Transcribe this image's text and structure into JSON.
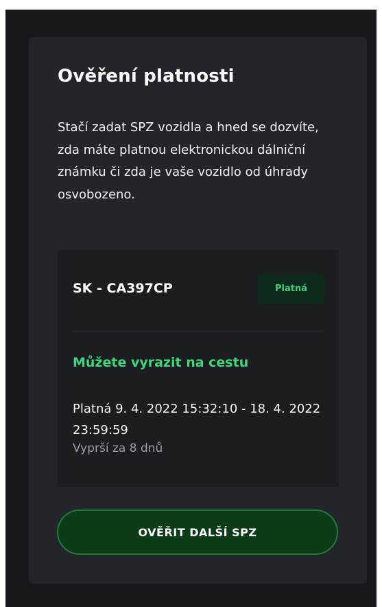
{
  "card": {
    "title": "Ověření platnosti",
    "description": "Stačí zadat SPZ vozidla a hned se dozvíte, zda máte platnou elektronickou dálniční známku či zda je vaše vozidlo od úhrady osvobozeno."
  },
  "result": {
    "plate": "SK - CA397CP",
    "status_badge": "Platná",
    "headline": "Můžete vyrazit na cestu",
    "validity_range": "Platná 9. 4. 2022 15:32:10 - 18. 4. 2022 23:59:59",
    "expires_in": "Vyprší za 8 dnů"
  },
  "actions": {
    "verify_another": "OVĚŘIT DALŠÍ SPZ"
  },
  "colors": {
    "background": "#16181b",
    "card": "#22262b",
    "result_box": "#1b1d20",
    "accent_green": "#3ed67e",
    "button_bg": "#0c3b18",
    "button_border": "#1f7a35"
  }
}
